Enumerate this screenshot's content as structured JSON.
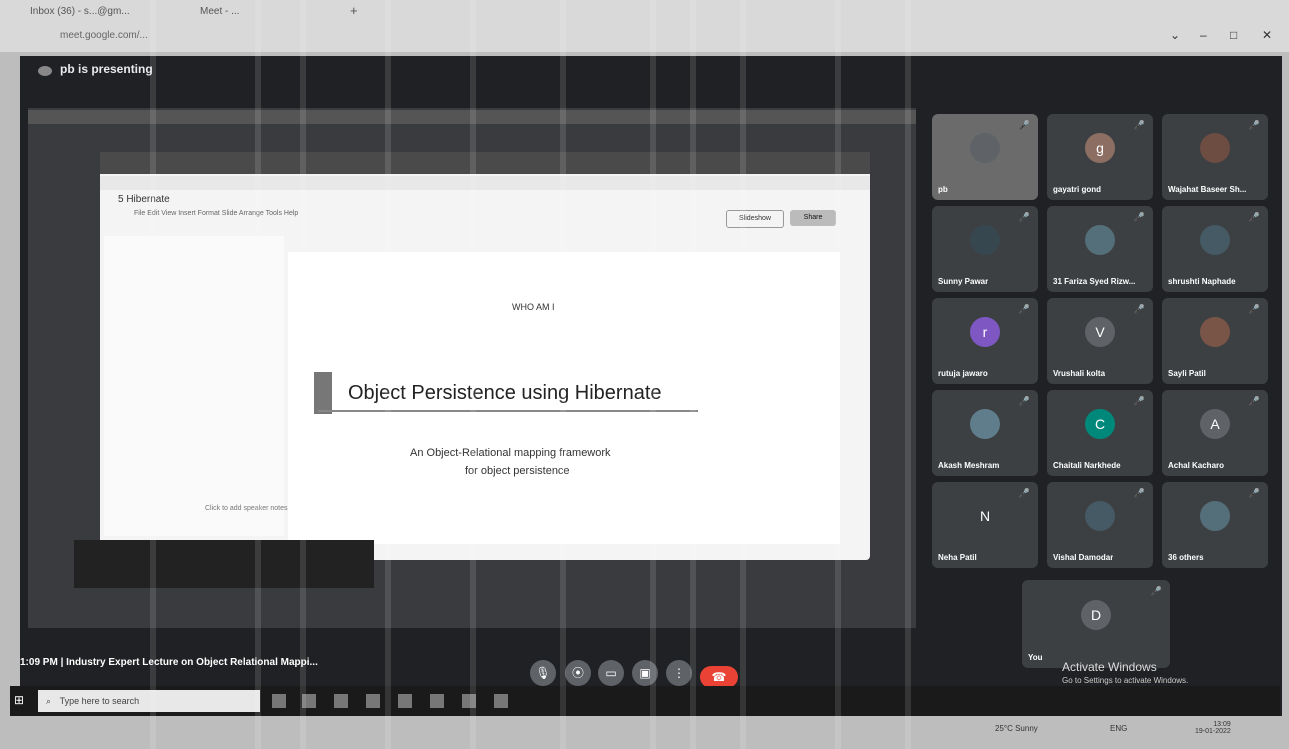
{
  "browser": {
    "tabs": [
      "Inbox (36) - s...@gm...",
      "Meet - ...",
      "+"
    ],
    "address": "meet.google.com/..."
  },
  "meet": {
    "presenting_label": "pb is presenting",
    "meeting_title": "1:09 PM  |  Industry Expert Lecture on Object Relational Mappi...",
    "activate_windows": "Activate Windows",
    "activate_hint": "Go to Settings to activate Windows."
  },
  "shared_screen": {
    "docs_title": "5 Hibernate",
    "docs_menu": "File  Edit  View  Insert  Format  Slide  Arrange  Tools  Help",
    "slideshow_label": "Slideshow",
    "share_label": "Share",
    "slide": {
      "heading_small": "WHO AM I",
      "title": "Object Persistence using Hibernate",
      "subtitle_line1": "An Object-Relational mapping framework",
      "subtitle_line2": "for object persistence"
    },
    "notes_hint": "Click to add speaker notes"
  },
  "participants": [
    {
      "name": "pb",
      "initial": ""
    },
    {
      "name": "gayatri gond",
      "initial": "g"
    },
    {
      "name": "Wajahat Baseer Sh...",
      "initial": ""
    },
    {
      "name": "Sunny Pawar",
      "initial": ""
    },
    {
      "name": "31 Fariza Syed Rizw...",
      "initial": ""
    },
    {
      "name": "shrushti Naphade",
      "initial": ""
    },
    {
      "name": "rutuja jawaro",
      "initial": "r"
    },
    {
      "name": "Vrushali kolta",
      "initial": "V"
    },
    {
      "name": "Sayli Patil",
      "initial": ""
    },
    {
      "name": "Akash Meshram",
      "initial": ""
    },
    {
      "name": "Chaitali Narkhede",
      "initial": "C"
    },
    {
      "name": "Achal Kacharo",
      "initial": "A"
    },
    {
      "name": "Neha Patil",
      "initial": "N"
    },
    {
      "name": "Vishal Damodar",
      "initial": ""
    },
    {
      "name": "36 others",
      "initial": ""
    },
    {
      "name": "You",
      "initial": "D"
    }
  ],
  "taskbar": {
    "search_placeholder": "Type here to search",
    "weather": "25°C  Sunny",
    "lang": "ENG",
    "time": "13:09",
    "date": "19-01-2022"
  },
  "colors": {
    "meet_bg": "#202124",
    "tile_bg": "#3c4043",
    "end_call": "#ea4335"
  }
}
